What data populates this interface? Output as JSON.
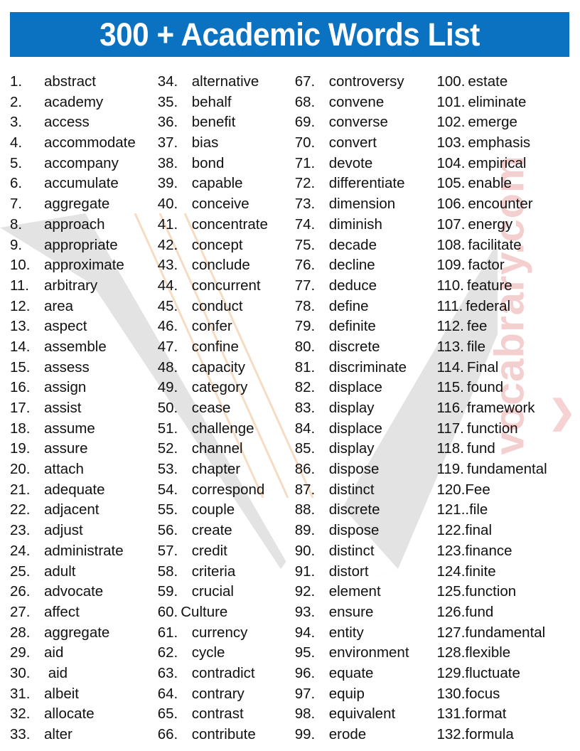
{
  "page": {
    "title_text": "300 + Academic Words List",
    "banner_color": "#0a72c0",
    "background_color": "#ffffff",
    "text_color": "#111111"
  },
  "watermarks": {
    "site_text": "vocabrary.com",
    "site_color": "#f4cfcf",
    "chevron_glyph": "❯",
    "shape_color": "#e2e2e2",
    "stripe_color": "#f6dcc6"
  },
  "columns": [
    {
      "index": 0,
      "items": [
        {
          "num": "1.",
          "word": "abstract",
          "gap": "wide"
        },
        {
          "num": "2.",
          "word": "academy",
          "gap": "wide"
        },
        {
          "num": "3.",
          "word": "access",
          "gap": "wide"
        },
        {
          "num": "4.",
          "word": "accommodate",
          "gap": "wide"
        },
        {
          "num": "5.",
          "word": "accompany",
          "gap": "wide"
        },
        {
          "num": "6.",
          "word": "accumulate",
          "gap": "wide"
        },
        {
          "num": "7.",
          "word": "aggregate",
          "gap": "wide"
        },
        {
          "num": "8.",
          "word": "approach",
          "gap": "wide"
        },
        {
          "num": "9.",
          "word": "appropriate",
          "gap": "wide"
        },
        {
          "num": "10.",
          "word": "approximate",
          "gap": "wide"
        },
        {
          "num": "11.",
          "word": "arbitrary",
          "gap": "wide"
        },
        {
          "num": "12.",
          "word": "area",
          "gap": "wide"
        },
        {
          "num": "13.",
          "word": "aspect",
          "gap": "wide"
        },
        {
          "num": "14.",
          "word": "assemble",
          "gap": "wide"
        },
        {
          "num": "15.",
          "word": "assess",
          "gap": "wide"
        },
        {
          "num": "16.",
          "word": "assign",
          "gap": "wide"
        },
        {
          "num": "17.",
          "word": "assist",
          "gap": "wide"
        },
        {
          "num": "18.",
          "word": "assume",
          "gap": "wide"
        },
        {
          "num": "19.",
          "word": "assure",
          "gap": "wide"
        },
        {
          "num": "20.",
          "word": "attach",
          "gap": "wide"
        },
        {
          "num": "21.",
          "word": "adequate",
          "gap": "wide"
        },
        {
          "num": "22.",
          "word": "adjacent",
          "gap": "wide"
        },
        {
          "num": "23.",
          "word": "adjust",
          "gap": "wide"
        },
        {
          "num": "24.",
          "word": "administrate",
          "gap": "wide"
        },
        {
          "num": "25.",
          "word": "adult",
          "gap": "wide"
        },
        {
          "num": "26.",
          "word": "advocate",
          "gap": "wide"
        },
        {
          "num": "27.",
          "word": "affect",
          "gap": "wide"
        },
        {
          "num": "28.",
          "word": "aggregate",
          "gap": "wide"
        },
        {
          "num": "29.",
          "word": "aid",
          "gap": "wide"
        },
        {
          "num": "30.",
          "word": " aid",
          "gap": "wide"
        },
        {
          "num": "31.",
          "word": "albeit",
          "gap": "wide"
        },
        {
          "num": "32.",
          "word": "allocate",
          "gap": "wide"
        },
        {
          "num": "33.",
          "word": "alter",
          "gap": "wide"
        }
      ]
    },
    {
      "index": 1,
      "items": [
        {
          "num": "34.",
          "word": "alternative",
          "gap": "wide"
        },
        {
          "num": "35.",
          "word": "behalf",
          "gap": "wide"
        },
        {
          "num": "36.",
          "word": "benefit",
          "gap": "wide"
        },
        {
          "num": "37.",
          "word": "bias",
          "gap": "wide"
        },
        {
          "num": "38.",
          "word": "bond",
          "gap": "wide"
        },
        {
          "num": "39.",
          "word": "capable",
          "gap": "wide"
        },
        {
          "num": "40.",
          "word": "conceive",
          "gap": "wide"
        },
        {
          "num": "41.",
          "word": "concentrate",
          "gap": "wide"
        },
        {
          "num": "42.",
          "word": "concept",
          "gap": "wide"
        },
        {
          "num": "43.",
          "word": "conclude",
          "gap": "wide"
        },
        {
          "num": "44.",
          "word": "concurrent",
          "gap": "wide"
        },
        {
          "num": "45.",
          "word": "conduct",
          "gap": "wide"
        },
        {
          "num": "46.",
          "word": "confer",
          "gap": "wide"
        },
        {
          "num": "47.",
          "word": "confine",
          "gap": "wide"
        },
        {
          "num": "48.",
          "word": "capacity",
          "gap": "wide"
        },
        {
          "num": "49.",
          "word": "category",
          "gap": "wide"
        },
        {
          "num": "50.",
          "word": "cease",
          "gap": "wide"
        },
        {
          "num": "51.",
          "word": "challenge",
          "gap": "wide"
        },
        {
          "num": "52.",
          "word": "channel",
          "gap": "wide"
        },
        {
          "num": "53.",
          "word": "chapter",
          "gap": "wide"
        },
        {
          "num": "54.",
          "word": "correspond",
          "gap": "wide"
        },
        {
          "num": "55.",
          "word": "couple",
          "gap": "wide"
        },
        {
          "num": "56.",
          "word": "create",
          "gap": "wide"
        },
        {
          "num": "57.",
          "word": "credit",
          "gap": "wide"
        },
        {
          "num": "58.",
          "word": "criteria",
          "gap": "wide"
        },
        {
          "num": "59.",
          "word": "crucial",
          "gap": "wide"
        },
        {
          "num": "60.",
          "word": "Culture",
          "gap": "narrow"
        },
        {
          "num": "61.",
          "word": "currency",
          "gap": "wide"
        },
        {
          "num": "62.",
          "word": "cycle",
          "gap": "wide"
        },
        {
          "num": "63.",
          "word": "contradict",
          "gap": "wide"
        },
        {
          "num": "64.",
          "word": "contrary",
          "gap": "wide"
        },
        {
          "num": "65.",
          "word": "contrast",
          "gap": "wide"
        },
        {
          "num": "66.",
          "word": "contribute",
          "gap": "wide"
        }
      ]
    },
    {
      "index": 2,
      "items": [
        {
          "num": "67.",
          "word": "controversy",
          "gap": "wide"
        },
        {
          "num": "68.",
          "word": "convene",
          "gap": "wide"
        },
        {
          "num": "69.",
          "word": "converse",
          "gap": "wide"
        },
        {
          "num": "70.",
          "word": "convert",
          "gap": "wide"
        },
        {
          "num": "71.",
          "word": "devote",
          "gap": "wide"
        },
        {
          "num": "72.",
          "word": "differentiate",
          "gap": "wide"
        },
        {
          "num": "73.",
          "word": "dimension",
          "gap": "wide"
        },
        {
          "num": "74.",
          "word": "diminish",
          "gap": "wide"
        },
        {
          "num": "75.",
          "word": "decade",
          "gap": "wide"
        },
        {
          "num": "76.",
          "word": "decline",
          "gap": "wide"
        },
        {
          "num": "77.",
          "word": "deduce",
          "gap": "wide"
        },
        {
          "num": "78.",
          "word": "define",
          "gap": "wide"
        },
        {
          "num": "79.",
          "word": "definite",
          "gap": "wide"
        },
        {
          "num": "80.",
          "word": "discrete",
          "gap": "wide"
        },
        {
          "num": "81.",
          "word": "discriminate",
          "gap": "wide"
        },
        {
          "num": "82.",
          "word": "displace",
          "gap": "wide"
        },
        {
          "num": "83.",
          "word": "display",
          "gap": "wide"
        },
        {
          "num": "84.",
          "word": "displace",
          "gap": "wide"
        },
        {
          "num": "85.",
          "word": "display",
          "gap": "wide"
        },
        {
          "num": "86.",
          "word": "dispose",
          "gap": "wide"
        },
        {
          "num": "87.",
          "word": "distinct",
          "gap": "wide"
        },
        {
          "num": "88.",
          "word": "discrete",
          "gap": "wide"
        },
        {
          "num": "89.",
          "word": "dispose",
          "gap": "wide"
        },
        {
          "num": "90.",
          "word": "distinct",
          "gap": "wide"
        },
        {
          "num": "91.",
          "word": "distort",
          "gap": "wide"
        },
        {
          "num": "92.",
          "word": "element",
          "gap": "wide"
        },
        {
          "num": "93.",
          "word": "ensure",
          "gap": "wide"
        },
        {
          "num": "94.",
          "word": "entity",
          "gap": "wide"
        },
        {
          "num": "95.",
          "word": "environment",
          "gap": "wide"
        },
        {
          "num": "96.",
          "word": "equate",
          "gap": "wide"
        },
        {
          "num": "97.",
          "word": "equip",
          "gap": "wide"
        },
        {
          "num": "98.",
          "word": "equivalent",
          "gap": "wide"
        },
        {
          "num": "99.",
          "word": "erode",
          "gap": "wide"
        }
      ]
    },
    {
      "index": 3,
      "items": [
        {
          "num": "100.",
          "word": "estate",
          "gap": "narrow"
        },
        {
          "num": "101.",
          "word": "eliminate",
          "gap": "narrow"
        },
        {
          "num": "102.",
          "word": "emerge",
          "gap": "narrow"
        },
        {
          "num": "103.",
          "word": "emphasis",
          "gap": "narrow"
        },
        {
          "num": "104.",
          "word": "empirical",
          "gap": "narrow"
        },
        {
          "num": "105.",
          "word": "enable",
          "gap": "narrow"
        },
        {
          "num": "106.",
          "word": "encounter",
          "gap": "narrow"
        },
        {
          "num": "107.",
          "word": "energy",
          "gap": "narrow"
        },
        {
          "num": "108.",
          "word": "facilitate",
          "gap": "narrow"
        },
        {
          "num": "109.",
          "word": "factor",
          "gap": "narrow"
        },
        {
          "num": "110.",
          "word": "feature",
          "gap": "narrow"
        },
        {
          "num": "111.",
          "word": "federal",
          "gap": "narrow"
        },
        {
          "num": "112.",
          "word": "fee",
          "gap": "narrow"
        },
        {
          "num": "113.",
          "word": "file",
          "gap": "narrow"
        },
        {
          "num": "114.",
          "word": "Final",
          "gap": "narrow"
        },
        {
          "num": "115.",
          "word": "found",
          "gap": "narrow"
        },
        {
          "num": "116.",
          "word": "framework",
          "gap": "narrow"
        },
        {
          "num": "117.",
          "word": "function",
          "gap": "narrow"
        },
        {
          "num": "118.",
          "word": "fund",
          "gap": "narrow"
        },
        {
          "num": "119.",
          "word": "fundamental",
          "gap": "narrow"
        },
        {
          "num": "120.",
          "word": "Fee",
          "gap": "none"
        },
        {
          "num": "121..",
          "word": "file",
          "gap": "none"
        },
        {
          "num": "122.",
          "word": "final",
          "gap": "none"
        },
        {
          "num": "123.",
          "word": "finance",
          "gap": "none"
        },
        {
          "num": "124.",
          "word": "finite",
          "gap": "none"
        },
        {
          "num": "125.",
          "word": "function",
          "gap": "none"
        },
        {
          "num": "126.",
          "word": "fund",
          "gap": "none"
        },
        {
          "num": "127.",
          "word": "fundamental",
          "gap": "none"
        },
        {
          "num": "128.",
          "word": "flexible",
          "gap": "none"
        },
        {
          "num": "129.",
          "word": "fluctuate",
          "gap": "none"
        },
        {
          "num": "130.",
          "word": "focus",
          "gap": "none"
        },
        {
          "num": "131.",
          "word": "format",
          "gap": "none"
        },
        {
          "num": "132.",
          "word": "formula",
          "gap": "none"
        }
      ]
    }
  ]
}
